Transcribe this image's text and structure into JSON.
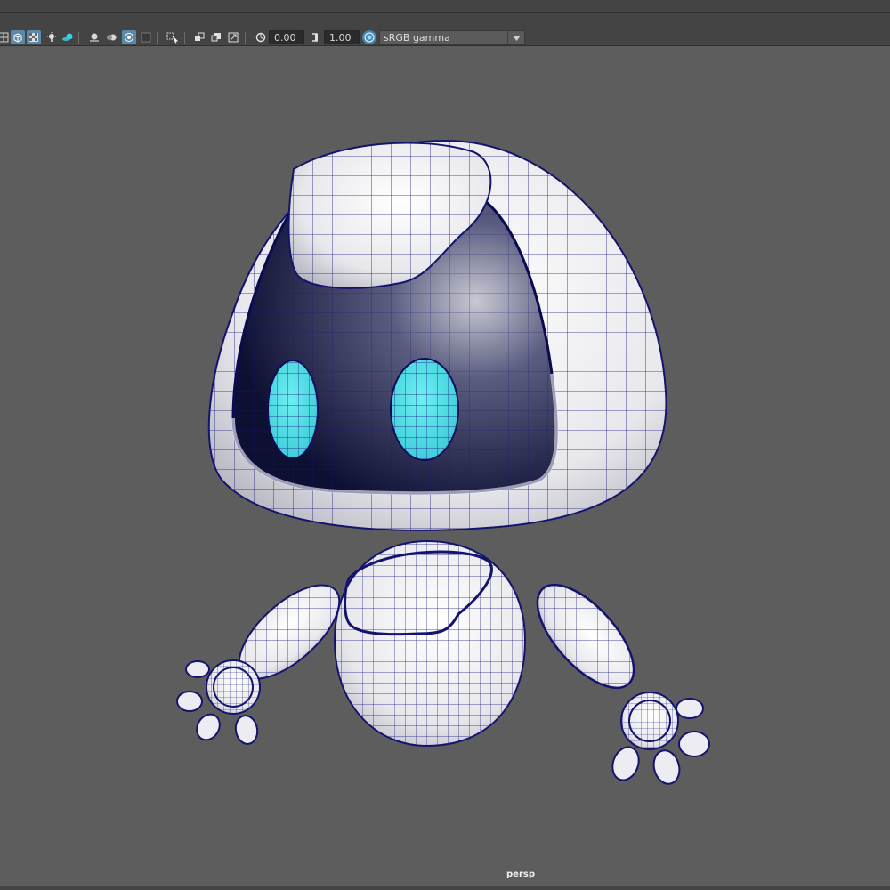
{
  "toolbar": {
    "exposure_value": "0.00",
    "gamma_value": "1.00",
    "color_space": "sRGB gamma",
    "icons": [
      "wireframe-shaded-icon",
      "smooth-shade-icon",
      "textured-icon",
      "lights-icon",
      "shadows-icon",
      "ambient-occlusion-icon",
      "motion-blur-icon",
      "anti-aliasing-icon",
      "depth-of-field-icon",
      "isolate-select-icon",
      "xray-icon",
      "xray-joints-icon",
      "backface-culling-icon",
      "exposure-icon",
      "gamma-icon",
      "color-management-icon"
    ]
  },
  "viewport": {
    "camera_label": "persp"
  },
  "colors": {
    "viewport_bg": "#5d5d5d",
    "toolbar_bg": "#444444",
    "active_toggle": "#5d89a8",
    "wire": "#14146e",
    "eye": "#4fe0e6",
    "visor": "#0d1033"
  }
}
